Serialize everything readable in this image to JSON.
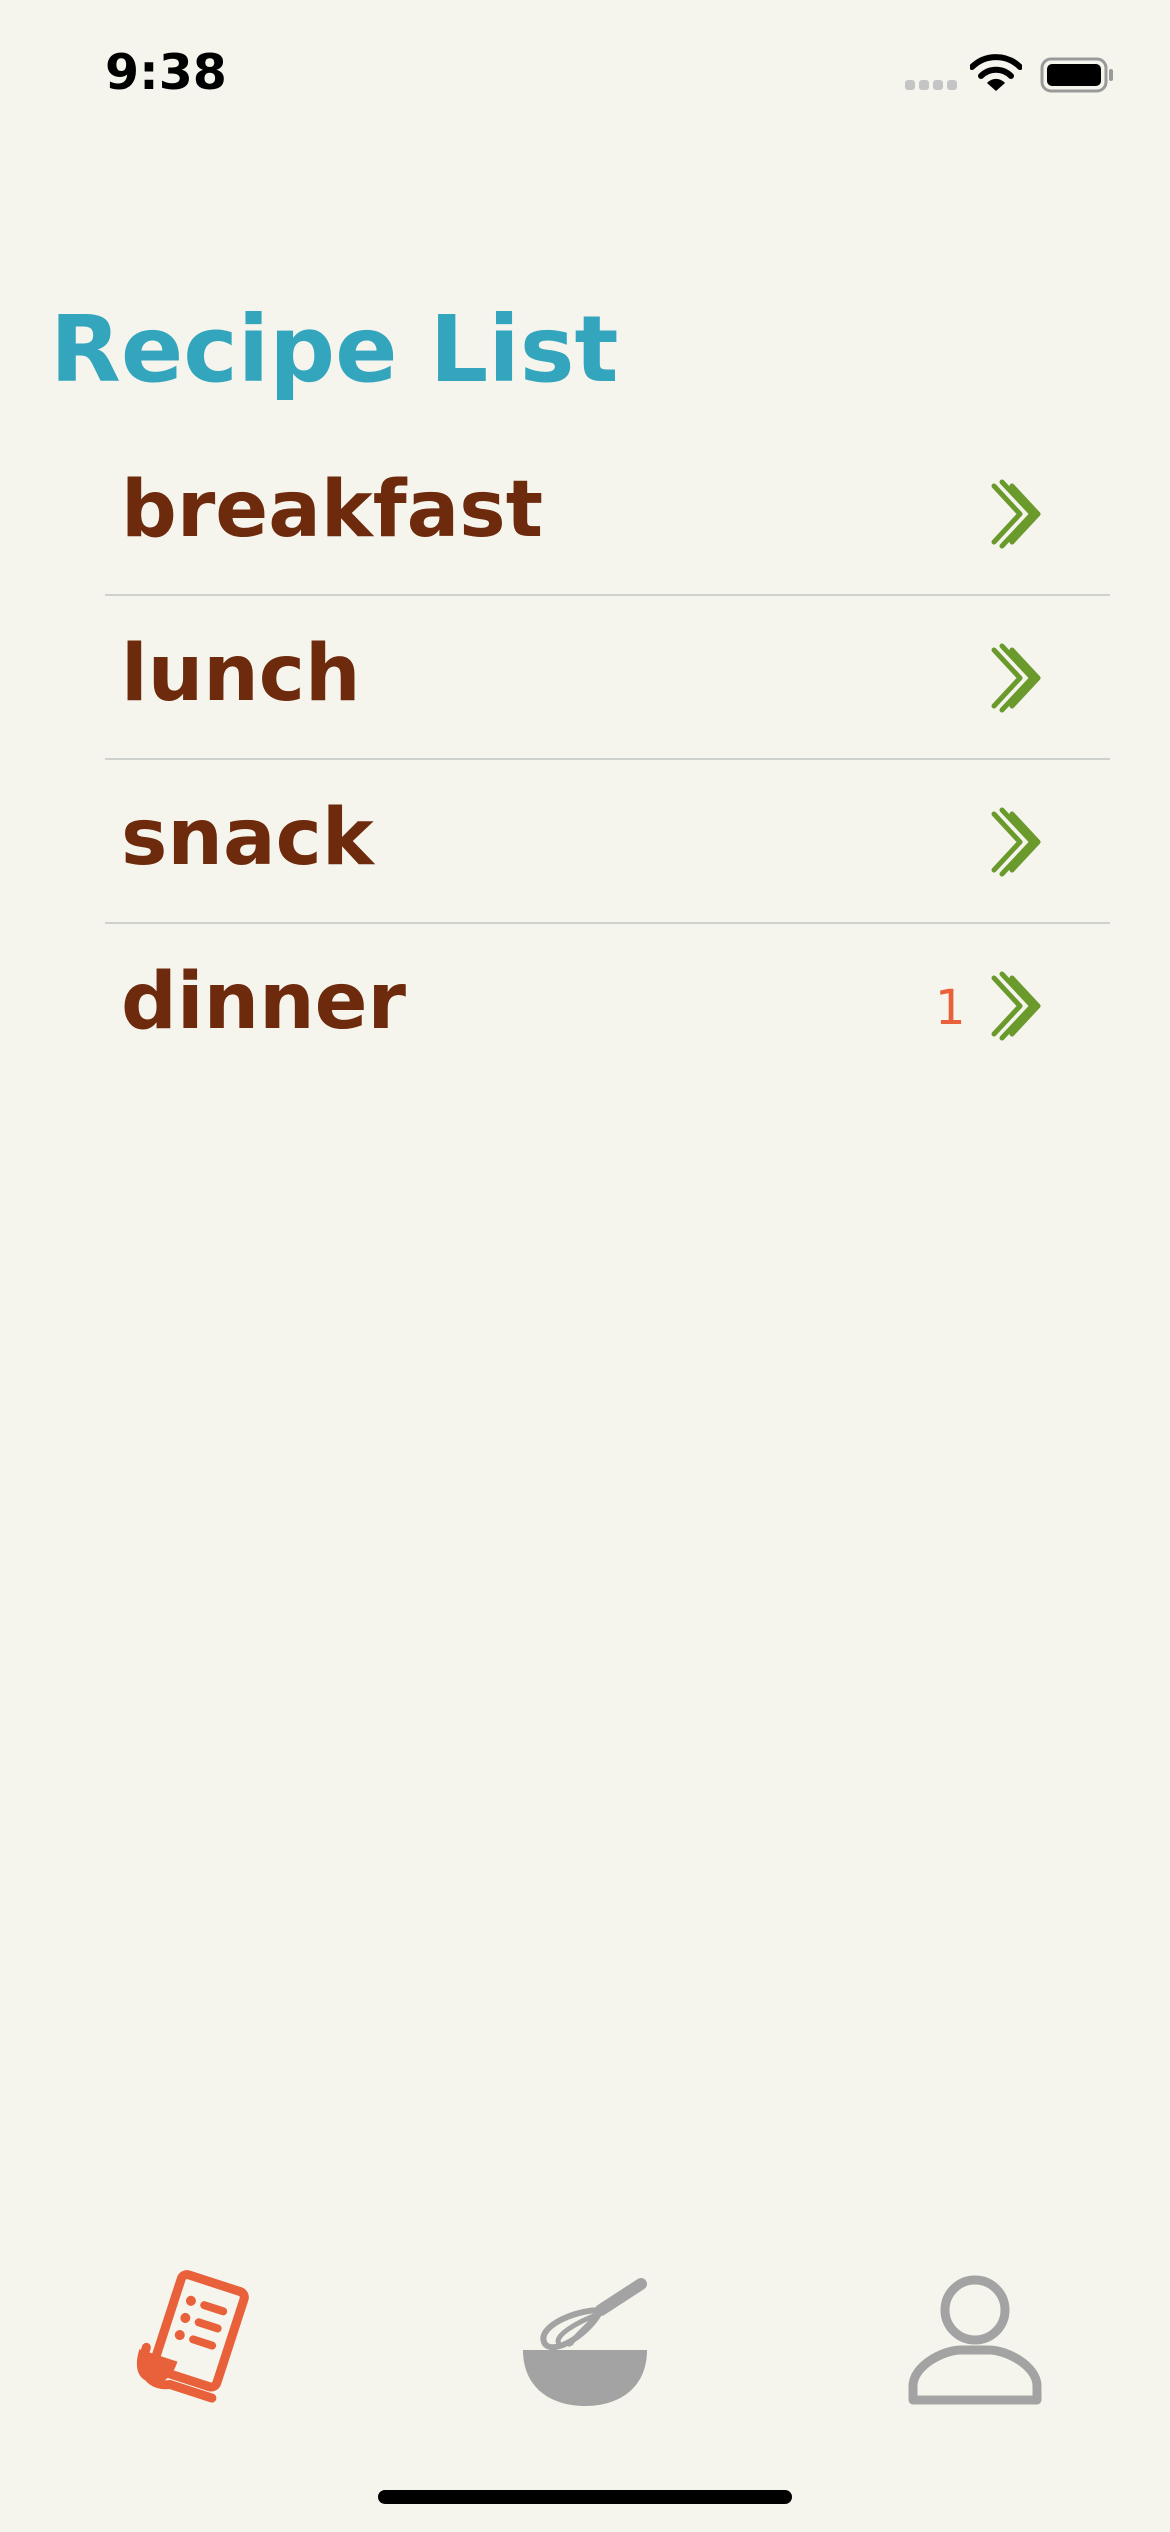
{
  "status_bar": {
    "time": "9:38",
    "icons": [
      "signal-icon",
      "wifi-icon",
      "battery-icon"
    ]
  },
  "page": {
    "title": "Recipe List"
  },
  "list": {
    "items": [
      {
        "label": "breakfast",
        "badge": ""
      },
      {
        "label": "lunch",
        "badge": ""
      },
      {
        "label": "snack",
        "badge": ""
      },
      {
        "label": "dinner",
        "badge": "1"
      }
    ]
  },
  "tab_bar": {
    "tabs": [
      {
        "icon": "recipe-list-icon",
        "selected": true
      },
      {
        "icon": "whisk-bowl-icon",
        "selected": false
      },
      {
        "icon": "profile-icon",
        "selected": false
      }
    ]
  },
  "colors": {
    "background": "#f5f5ee",
    "title": "#33a5bd",
    "item_text": "#6e2a0c",
    "chevron": "#6b9a2c",
    "badge": "#e8613a",
    "tab_active": "#e8613a",
    "tab_inactive": "#a3a3a3"
  }
}
